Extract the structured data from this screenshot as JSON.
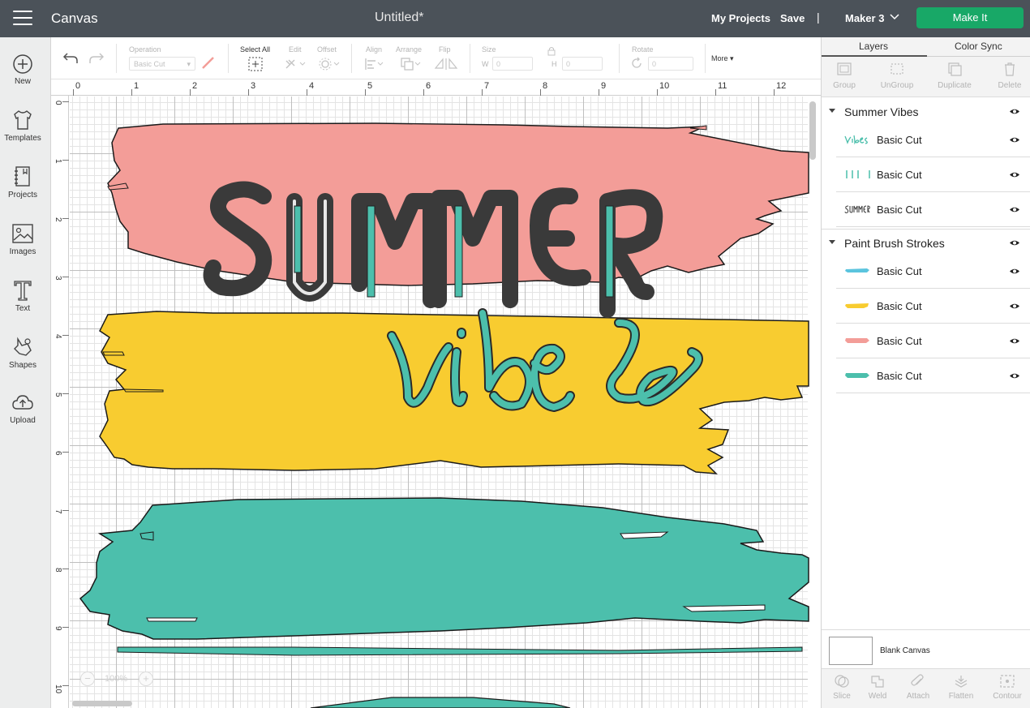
{
  "topbar": {
    "app_name": "Canvas",
    "document_title": "Untitled*",
    "my_projects": "My Projects",
    "save": "Save",
    "separator": "|",
    "machine": "Maker 3",
    "make_it": "Make It"
  },
  "sidebar": {
    "items": [
      {
        "label": "New",
        "icon": "plus-circle-icon"
      },
      {
        "label": "Templates",
        "icon": "tshirt-icon"
      },
      {
        "label": "Projects",
        "icon": "notebook-icon"
      },
      {
        "label": "Images",
        "icon": "image-icon"
      },
      {
        "label": "Text",
        "icon": "text-icon"
      },
      {
        "label": "Shapes",
        "icon": "shapes-icon"
      },
      {
        "label": "Upload",
        "icon": "cloud-upload-icon"
      }
    ]
  },
  "toolbar": {
    "operation_label": "Operation",
    "operation_value": "Basic Cut",
    "select_all": "Select All",
    "edit": "Edit",
    "offset": "Offset",
    "align": "Align",
    "arrange": "Arrange",
    "flip": "Flip",
    "size": "Size",
    "w_label": "W",
    "w_value": "0",
    "h_label": "H",
    "h_value": "0",
    "rotate": "Rotate",
    "rotate_value": "0",
    "more": "More"
  },
  "canvas": {
    "ruler_top": [
      "0",
      "1",
      "2",
      "3",
      "4",
      "5",
      "6",
      "7",
      "8",
      "9",
      "10",
      "11",
      "12"
    ],
    "ruler_left": [
      "0",
      "1",
      "2",
      "3",
      "4",
      "5",
      "6",
      "7",
      "8",
      "9",
      "10"
    ],
    "zoom_level": "100%",
    "zoom_minus": "−",
    "zoom_plus": "+",
    "colors": {
      "pink": "#f39d98",
      "yellow": "#f8cc30",
      "teal": "#4cbfac",
      "dark": "#3a3a3a"
    }
  },
  "layers_panel": {
    "tab_layers": "Layers",
    "tab_color_sync": "Color Sync",
    "actions": [
      "Group",
      "UnGroup",
      "Duplicate",
      "Delete"
    ],
    "groups": [
      {
        "name": "Summer Vibes",
        "layers": [
          {
            "thumb": "vibes",
            "name": "Basic Cut",
            "color": "#4cbfac"
          },
          {
            "thumb": "bars",
            "name": "Basic Cut",
            "color": "#4cbfac"
          },
          {
            "thumb": "summer",
            "name": "Basic Cut",
            "color": "#3a3a3a"
          }
        ]
      },
      {
        "name": "Paint Brush Strokes",
        "layers": [
          {
            "thumb": "stroke",
            "name": "Basic Cut",
            "color": "#5bc4de"
          },
          {
            "thumb": "stroke",
            "name": "Basic Cut",
            "color": "#f8cc30"
          },
          {
            "thumb": "stroke",
            "name": "Basic Cut",
            "color": "#f39d98"
          },
          {
            "thumb": "stroke",
            "name": "Basic Cut",
            "color": "#4cbfac"
          }
        ]
      }
    ],
    "blank_canvas": "Blank Canvas",
    "bottom_actions": [
      "Slice",
      "Weld",
      "Attach",
      "Flatten",
      "Contour"
    ]
  }
}
